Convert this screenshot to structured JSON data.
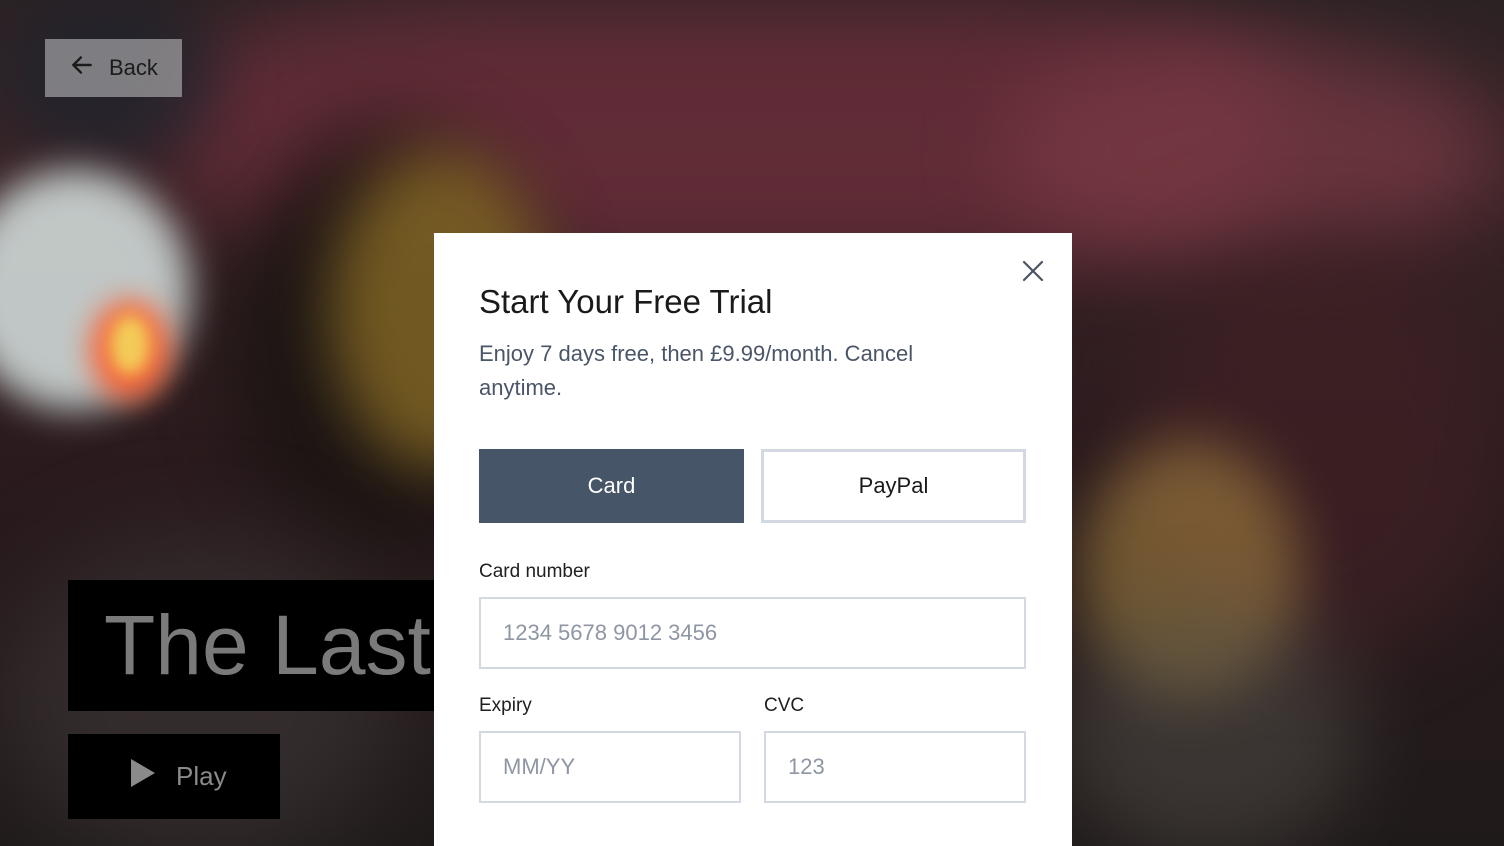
{
  "navigation": {
    "back_label": "Back"
  },
  "hero": {
    "title": "The Last",
    "play_label": "Play"
  },
  "modal": {
    "title": "Start Your Free Trial",
    "subtitle": "Enjoy 7 days free, then £9.99/month. Cancel anytime.",
    "payment_methods": [
      {
        "label": "Card",
        "selected": true
      },
      {
        "label": "PayPal",
        "selected": false
      }
    ],
    "fields": {
      "card_number": {
        "label": "Card number",
        "placeholder": "1234 5678 9012 3456",
        "value": ""
      },
      "expiry": {
        "label": "Expiry",
        "placeholder": "MM/YY",
        "value": ""
      },
      "cvc": {
        "label": "CVC",
        "placeholder": "123",
        "value": ""
      }
    }
  },
  "icons": {
    "back": "arrow-left-icon",
    "play": "play-icon",
    "close": "close-icon"
  },
  "colors": {
    "selected_method_bg": "#475569",
    "subtitle_text": "#4a5668",
    "input_border": "#d3d9e2"
  }
}
